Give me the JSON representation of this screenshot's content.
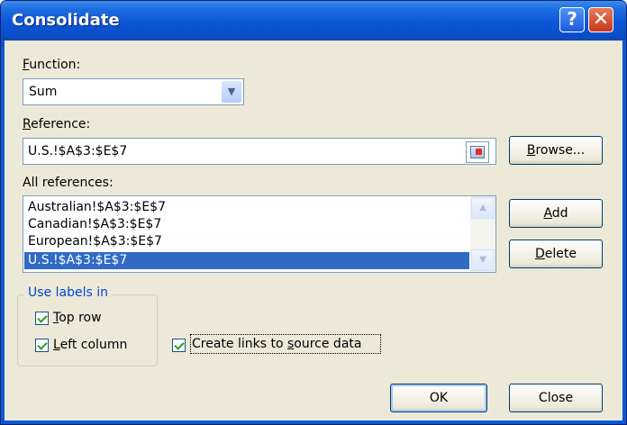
{
  "window": {
    "title": "Consolidate",
    "help_glyph": "?",
    "close_glyph": "✕"
  },
  "function": {
    "label_mnemonic": "F",
    "label_rest": "unction:",
    "value": "Sum",
    "options_visible": [
      "Sum"
    ]
  },
  "reference": {
    "label_mnemonic": "R",
    "label_rest": "eference:",
    "value": "U.S.!$A$3:$E$7"
  },
  "all_references": {
    "label": "All references:",
    "items": [
      {
        "text": "Australian!$A$3:$E$7",
        "selected": false
      },
      {
        "text": "Canadian!$A$3:$E$7",
        "selected": false
      },
      {
        "text": "European!$A$3:$E$7",
        "selected": false
      },
      {
        "text": "U.S.!$A$3:$E$7",
        "selected": true
      }
    ]
  },
  "buttons": {
    "browse": {
      "mnemonic": "B",
      "rest": "rowse..."
    },
    "add": {
      "mnemonic": "A",
      "rest": "dd"
    },
    "delete": {
      "mnemonic": "D",
      "rest": "elete"
    },
    "ok": "OK",
    "close": "Close"
  },
  "use_labels": {
    "title": "Use labels in",
    "top_row": {
      "mnemonic": "T",
      "rest": "op row",
      "checked": true
    },
    "left_column": {
      "mnemonic": "L",
      "rest": "eft column",
      "checked": true
    }
  },
  "create_links": {
    "pre": "Create links to ",
    "mnemonic": "s",
    "post": "ource data",
    "checked": true
  },
  "icons": {
    "collapse_dialog": "collapse-dialog-icon",
    "scroll_up": "scroll-up-arrow-icon",
    "scroll_down": "scroll-down-arrow-icon",
    "combo_arrow": "chevron-down-icon"
  },
  "colors": {
    "titlebar": "#0b56d6",
    "selection": "#316ac5",
    "dialog_bg": "#ece9d8",
    "groupbox_title": "#0046d5",
    "checkmark": "#21a121"
  }
}
